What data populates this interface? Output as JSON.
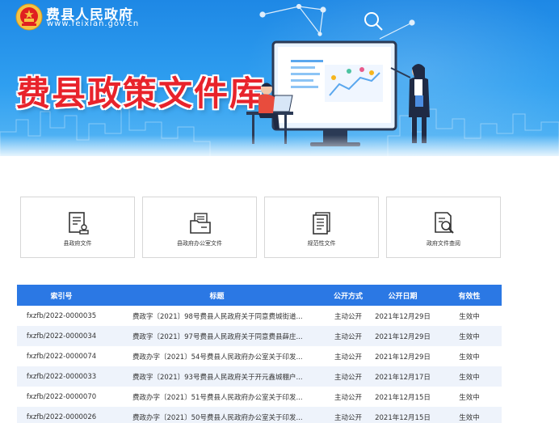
{
  "header": {
    "site_name": "费县人民政府",
    "site_url": "www.feixian.gov.cn",
    "banner_title": "费县政策文件库"
  },
  "colors": {
    "banner_blue": "#1e88e5",
    "title_red": "#e8232b",
    "table_header_blue": "#2b78e4",
    "row_stripe": "#eef3fb"
  },
  "icons": {
    "emblem": "national-emblem-icon",
    "card_0": "document-stamp-icon",
    "card_1": "folder-document-icon",
    "card_2": "document-list-icon",
    "card_3": "document-search-icon"
  },
  "categories": [
    {
      "label": "县政府文件"
    },
    {
      "label": "县政府办公室文件"
    },
    {
      "label": "规范性文件"
    },
    {
      "label": "政府文件查阅"
    }
  ],
  "table": {
    "headers": {
      "index": "索引号",
      "title": "标题",
      "mode": "公开方式",
      "date": "公开日期",
      "validity": "有效性"
    },
    "rows": [
      {
        "index": "fxzfb/2022-0000035",
        "title": "费政字〔2021〕98号费县人民政府关于同意费城街道...",
        "mode": "主动公开",
        "date": "2021年12月29日",
        "validity": "生效中"
      },
      {
        "index": "fxzfb/2022-0000034",
        "title": "费政字〔2021〕97号费县人民政府关于同意费县薛庄...",
        "mode": "主动公开",
        "date": "2021年12月29日",
        "validity": "生效中"
      },
      {
        "index": "fxzfb/2022-0000074",
        "title": "费政办字〔2021〕54号费县人民政府办公室关于印发...",
        "mode": "主动公开",
        "date": "2021年12月29日",
        "validity": "生效中"
      },
      {
        "index": "fxzfb/2022-0000033",
        "title": "费政字〔2021〕93号费县人民政府关于开元鑫城棚户...",
        "mode": "主动公开",
        "date": "2021年12月17日",
        "validity": "生效中"
      },
      {
        "index": "fxzfb/2022-0000070",
        "title": "费政办字〔2021〕51号费县人民政府办公室关于印发...",
        "mode": "主动公开",
        "date": "2021年12月15日",
        "validity": "生效中"
      },
      {
        "index": "fxzfb/2022-0000026",
        "title": "费政办字〔2021〕50号费县人民政府办公室关于印发...",
        "mode": "主动公开",
        "date": "2021年12月15日",
        "validity": "生效中"
      }
    ]
  }
}
